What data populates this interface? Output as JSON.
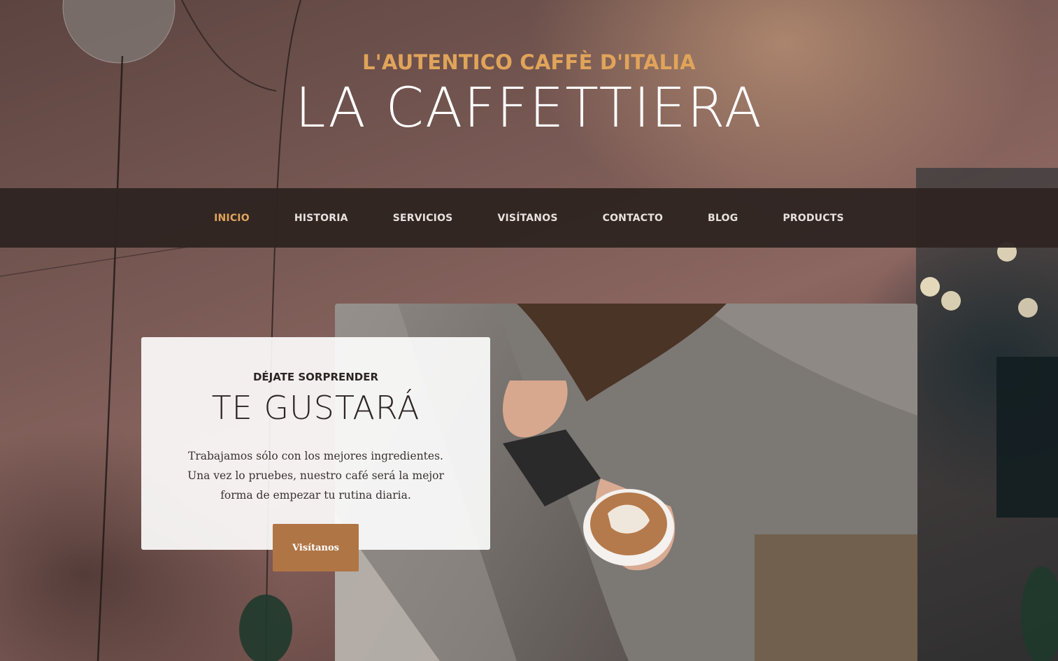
{
  "header": {
    "kicker": "L'AUTENTICO CAFFÈ D'ITALIA",
    "brand": "LA CAFFETTIERA"
  },
  "nav": {
    "items": [
      {
        "label": "INICIO",
        "active": true
      },
      {
        "label": "HISTORIA",
        "active": false
      },
      {
        "label": "SERVICIOS",
        "active": false
      },
      {
        "label": "VISÍTANOS",
        "active": false
      },
      {
        "label": "CONTACTO",
        "active": false
      },
      {
        "label": "BLOG",
        "active": false
      },
      {
        "label": "PRODUCTS",
        "active": false
      }
    ]
  },
  "intro": {
    "kicker": "DÉJATE SORPRENDER",
    "title": "TE GUSTARÁ",
    "text": "Trabajamos sólo con los mejores ingredientes. Una vez lo pruebes, nuestro café será la mejor forma de empezar tu rutina diaria.",
    "button_label": "Visítanos"
  },
  "colors": {
    "accent": "#e0a45a",
    "nav_bg": "#2f2421",
    "button_bg": "#b07545"
  }
}
